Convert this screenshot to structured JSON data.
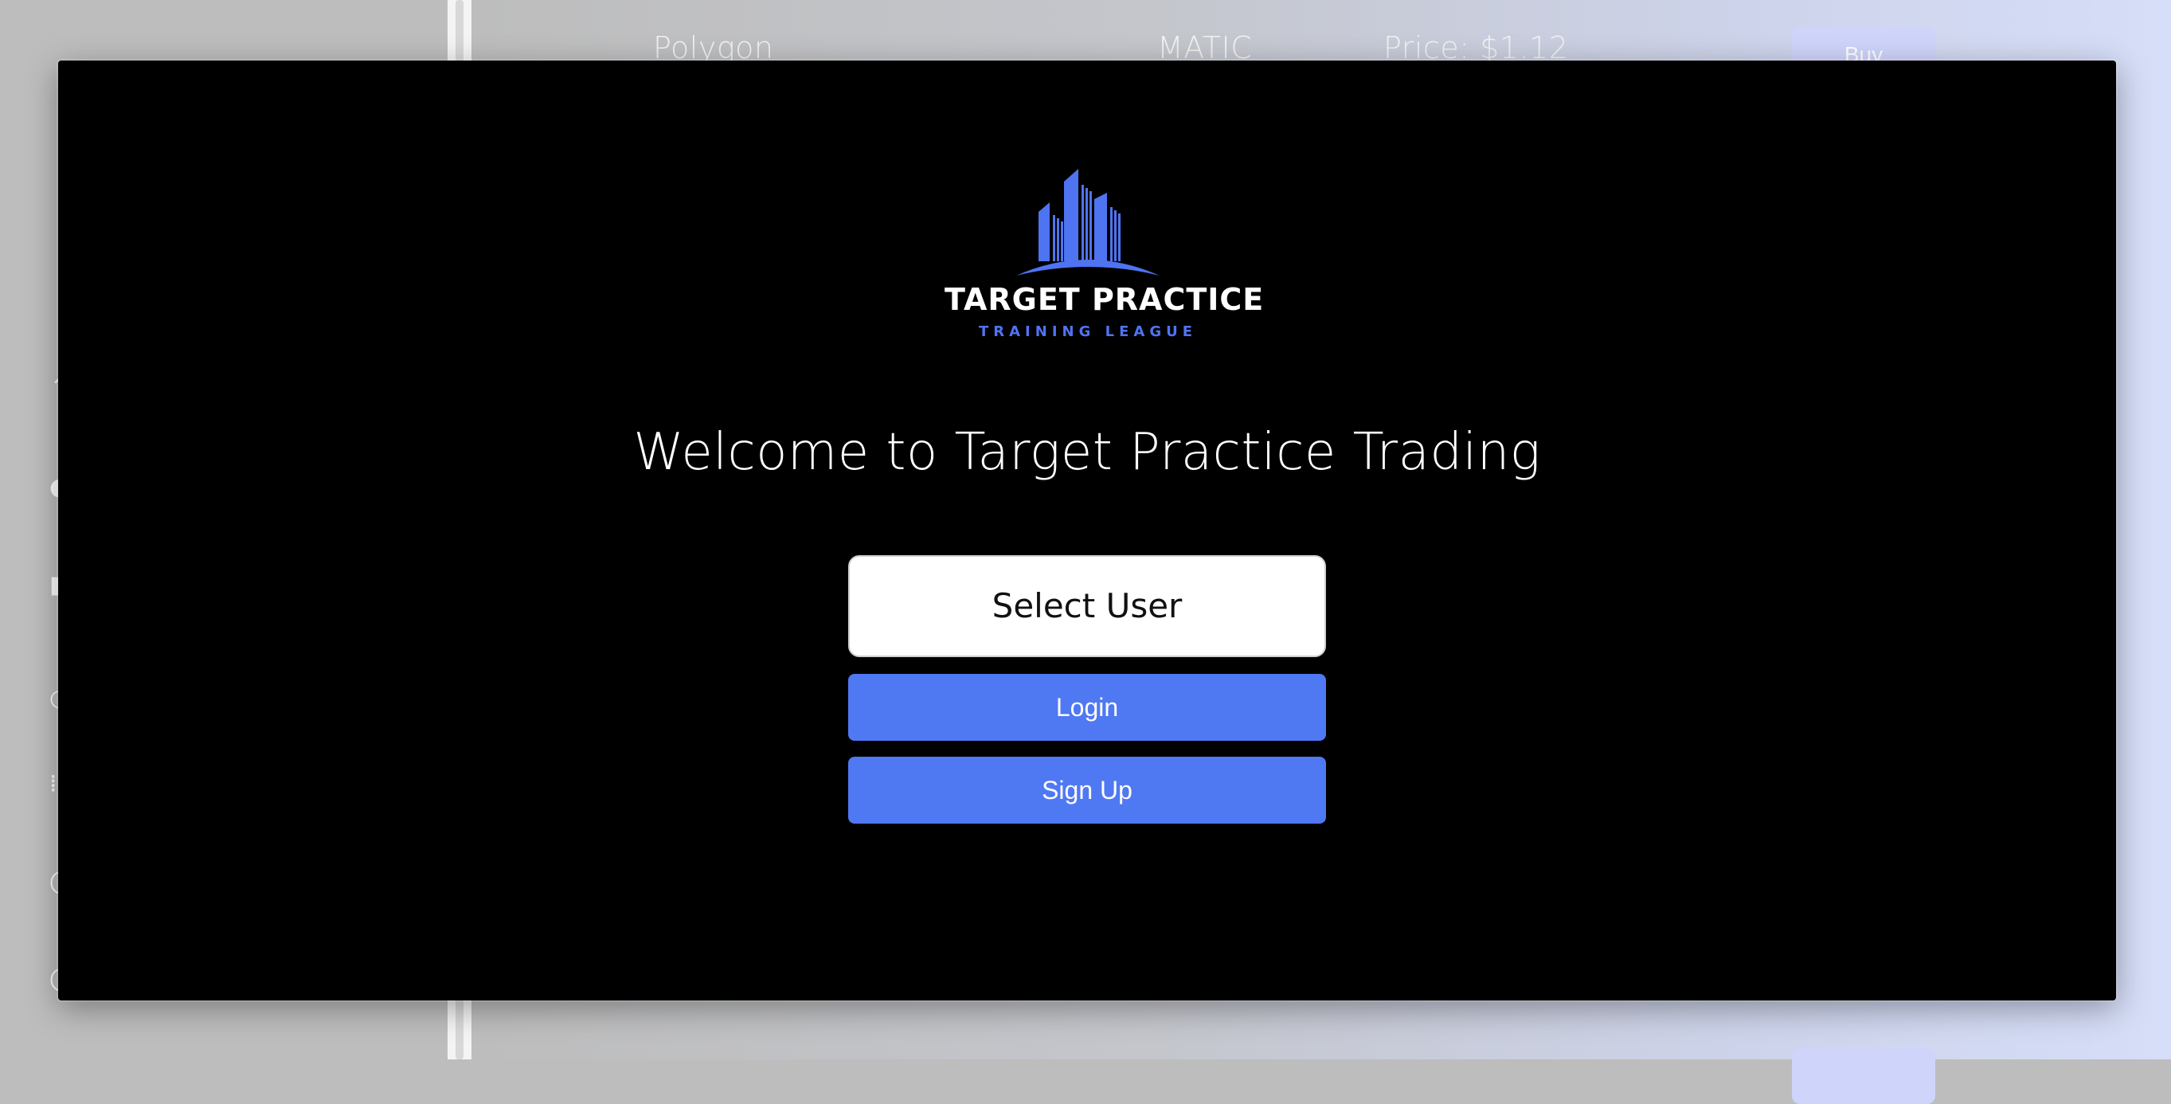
{
  "background": {
    "row_top": {
      "name": "Polygon",
      "symbol": "MATIC",
      "price": "Price: $1.12",
      "buy_label": "Buy"
    }
  },
  "modal": {
    "logo": {
      "icon": "city-skyline-logo",
      "title": "TARGET PRACTICE",
      "subtitle": "TRAINING LEAGUE"
    },
    "welcome_text": "Welcome to Target Practice Trading",
    "select_user_label": "Select User",
    "login_label": "Login",
    "signup_label": "Sign Up"
  },
  "colors": {
    "accent": "#4f78f3",
    "modal_bg": "#000000"
  }
}
